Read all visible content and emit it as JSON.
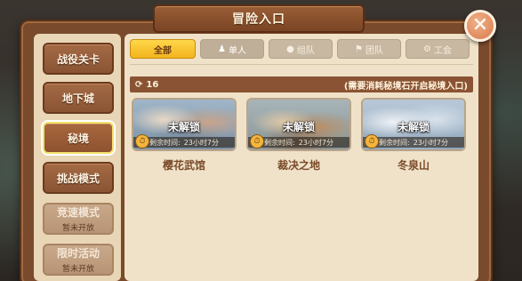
{
  "window": {
    "title": "冒险入口",
    "close_glyph": "✕"
  },
  "sidebar": {
    "items": [
      {
        "label": "战役关卡",
        "sub": "",
        "state": "normal"
      },
      {
        "label": "地下城",
        "sub": "",
        "state": "normal"
      },
      {
        "label": "秘境",
        "sub": "",
        "state": "active"
      },
      {
        "label": "挑战模式",
        "sub": "",
        "state": "normal"
      },
      {
        "label": "竞速模式",
        "sub": "暂未开放",
        "state": "disabled"
      },
      {
        "label": "限时活动",
        "sub": "暂未开放",
        "state": "disabled"
      }
    ]
  },
  "filters": [
    {
      "label": "全部",
      "icon": "",
      "active": true
    },
    {
      "label": "单人",
      "icon": "person-icon",
      "active": false
    },
    {
      "label": "组队",
      "icon": "team-icon",
      "active": false
    },
    {
      "label": "团队",
      "icon": "flag-icon",
      "active": false
    },
    {
      "label": "工会",
      "icon": "gear-icon",
      "active": false
    }
  ],
  "info_bar": {
    "refresh_icon": "refresh-icon",
    "key_count": "16",
    "notice": "(需要消耗秘境石开启秘境入口)"
  },
  "cards": [
    {
      "name": "樱花武馆",
      "status": "未解锁",
      "time_label": "剩余时间:",
      "time_value": "23小时7分"
    },
    {
      "name": "裁决之地",
      "status": "未解锁",
      "time_label": "剩余时间:",
      "time_value": "23小时7分"
    },
    {
      "name": "冬泉山",
      "status": "未解锁",
      "time_label": "剩余时间:",
      "time_value": "23小时7分"
    }
  ],
  "colors": {
    "frame": "#7a4a2c",
    "accent_yellow": "#f2b31c",
    "panel": "#efe2c8",
    "button_brown": "#8a5434"
  }
}
